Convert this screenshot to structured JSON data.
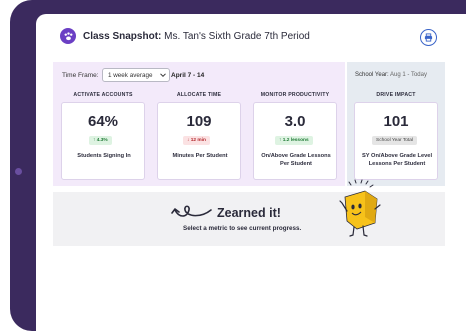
{
  "header": {
    "title_prefix": "Class Snapshot:",
    "title_class": "Ms. Tan's Sixth Grade 7th Period"
  },
  "filters": {
    "time_frame_label": "Time Frame:",
    "time_frame_value": "1 week average",
    "date_range": "April 7 - 14",
    "school_year_label": "School Year:",
    "school_year_value": "Aug 1 - Today"
  },
  "metrics": [
    {
      "heading": "ACTIVATE ACCOUNTS",
      "value": "64%",
      "badge": "4.3%",
      "trend": "up",
      "label": "Students Signing In"
    },
    {
      "heading": "ALLOCATE TIME",
      "value": "109",
      "badge": "12 min",
      "trend": "down",
      "label": "Minutes Per Student"
    },
    {
      "heading": "MONITOR PRODUCTIVITY",
      "value": "3.0",
      "badge": "1.2 lessons",
      "trend": "up",
      "label": "On/Above Grade Lessons Per Student"
    }
  ],
  "drive_impact": {
    "heading": "DRIVE IMPACT",
    "value": "101",
    "badge": "School Year Total",
    "label": "SY On/Above Grade Level Lessons Per Student"
  },
  "zearn": {
    "title": "Zearned it!",
    "subtitle": "Select a metric to see current progress."
  },
  "colors": {
    "accent": "#6b3fc4",
    "frame": "#3b2a5e",
    "up": "#1f7a35",
    "down": "#b3262c",
    "mascot": "#f7c21a"
  },
  "icons": {
    "logo": "paw-icon",
    "print": "print-icon",
    "dropdown": "chevron-down-icon",
    "trend_up": "arrow-up-icon",
    "trend_down": "arrow-down-icon"
  }
}
